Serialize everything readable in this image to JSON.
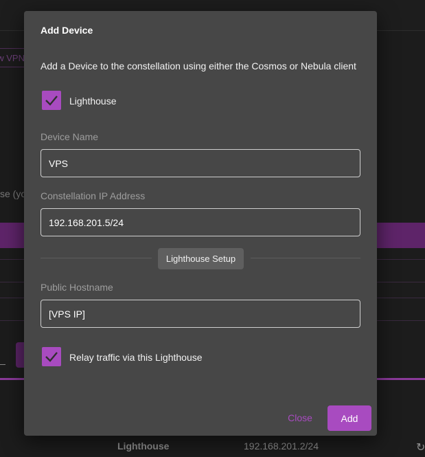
{
  "background": {
    "chip_text": "w VPN",
    "partial_text": "se (yo",
    "table_row": {
      "name": "Lighthouse",
      "ip": "192.168.201.2/24"
    }
  },
  "dialog": {
    "title": "Add Device",
    "description": "Add a Device to the constellation using either the Cosmos or Nebula client",
    "lighthouse_checkbox": {
      "label": "Lighthouse",
      "checked": true
    },
    "device_name": {
      "label": "Device Name",
      "value": "VPS"
    },
    "ip_address": {
      "label": "Constellation IP Address",
      "value": "192.168.201.5/24"
    },
    "section_button": "Lighthouse Setup",
    "public_hostname": {
      "label": "Public Hostname",
      "value": "[VPS IP]"
    },
    "relay_checkbox": {
      "label": "Relay traffic via this Lighthouse",
      "checked": true
    },
    "close_label": "Close",
    "add_label": "Add"
  },
  "colors": {
    "accent": "#a84bc0",
    "dialog_bg": "#474747",
    "page_bg": "#1c1c1c"
  },
  "icons": {
    "checkbox_mark": "check-icon",
    "refresh": "refresh-icon"
  }
}
